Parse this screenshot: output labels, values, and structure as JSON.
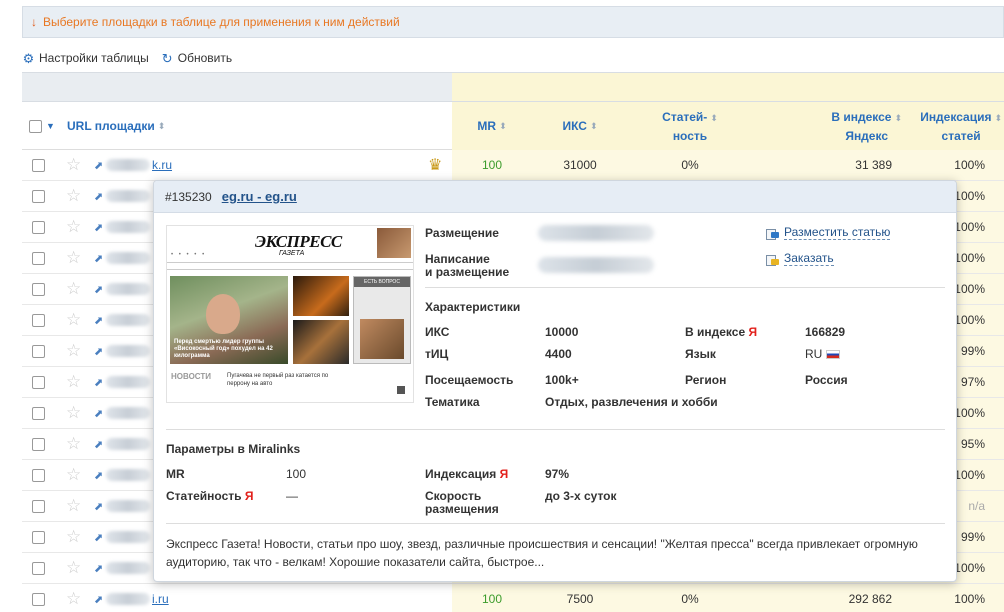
{
  "notice": {
    "arrow": "↓",
    "text": "Выберите площадки в таблице для применения к ним действий"
  },
  "toolbar": {
    "settings_label": "Настройки таблицы",
    "refresh_label": "Обновить"
  },
  "table": {
    "headers": {
      "url": "URL площадки",
      "mr": "MR",
      "iks": "ИКС",
      "articles_1": "Статей-",
      "articles_2": "ность",
      "index_yandex_1": "В индексе",
      "index_yandex_2": "Яндекс",
      "indexing_1": "Индексация",
      "indexing_2": "статей"
    },
    "rows": [
      {
        "url_suffix": "k.ru",
        "mr": "100",
        "iks": "31000",
        "articles": "0%",
        "index_yandex": "31 389",
        "indexing": "100%",
        "crown": "♛"
      },
      {
        "url_suffix": "",
        "indexing": "100%"
      },
      {
        "url_suffix": "",
        "indexing": "100%"
      },
      {
        "url_suffix": "",
        "indexing": "100%"
      },
      {
        "url_suffix": "",
        "indexing": "100%"
      },
      {
        "url_suffix": "",
        "indexing": "100%"
      },
      {
        "url_suffix": "",
        "indexing": "99%"
      },
      {
        "url_suffix": "",
        "indexing": "97%"
      },
      {
        "url_suffix": "",
        "indexing": "100%"
      },
      {
        "url_suffix": "",
        "indexing": "95%"
      },
      {
        "url_suffix": "",
        "indexing": "100%"
      },
      {
        "url_suffix": "",
        "indexing": "n/a"
      },
      {
        "url_suffix": "",
        "indexing": "99%"
      },
      {
        "url_suffix": "",
        "indexing": "100%"
      },
      {
        "url_suffix": "i.ru",
        "mr": "100",
        "iks": "7500",
        "articles": "0%",
        "index_yandex": "292 862",
        "indexing": "100%"
      }
    ]
  },
  "popup": {
    "id": "#135230",
    "title": "eg.ru - eg.ru",
    "screenshot": {
      "logo": "ЭКСПРЕСС",
      "logo_sub": "ГАЗЕТА",
      "headline": "Перед смертью лидер группы «Високосный год» похудел на 42 килограмма",
      "news": "НОВОСТИ",
      "news_text": "Пугачева не первый раз катается по перрону на авто",
      "side_label": "ЕСТЬ ВОПРОС"
    },
    "placement_label": "Размещение",
    "writing_label_1": "Написание",
    "writing_label_2": "и размещение",
    "place_article": "Разместить статью",
    "order": "Заказать",
    "characteristics_title": "Характеристики",
    "iks_label": "ИКС",
    "iks_value": "10000",
    "tic_label": "тИЦ",
    "tic_value": "4400",
    "traffic_label": "Посещаемость",
    "traffic_value": "100k+",
    "topic_label": "Тематика",
    "topic_value": "Отдых, развлечения и хобби",
    "in_index_label": "В индексе",
    "ya_letter": "Я",
    "in_index_value": "166829",
    "lang_label": "Язык",
    "lang_value": "RU",
    "region_label": "Регион",
    "region_value": "Россия",
    "params_title": "Параметры в Miralinks",
    "mr_label": "MR",
    "mr_value": "100",
    "articles_label": "Статейность",
    "articles_value": "—",
    "indexing_label": "Индексация",
    "indexing_value": "97%",
    "speed_label_1": "Скорость",
    "speed_label_2": "размещения",
    "speed_value": "до 3-х суток",
    "description": "Экспресс Газета! Новости, статьи про шоу, звезд, различные происшествия и сенсации! \"Желтая пресса\" всегда привлекает огромную аудиторию, так что - велкам! Хорошие показатели сайта, быстрое..."
  },
  "colors": {
    "accent": "#2a6ebb",
    "notice": "#e87722",
    "green": "#3c9c2c",
    "yandex": "#e2211c",
    "highlight": "#fbf6d5"
  }
}
